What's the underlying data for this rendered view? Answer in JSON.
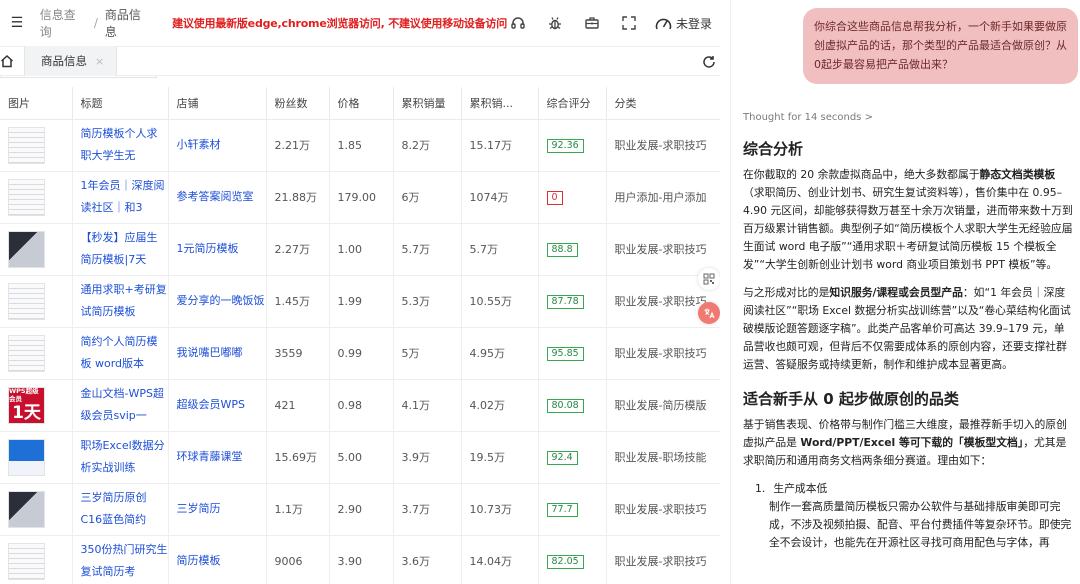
{
  "header": {
    "breadcrumb_1": "信息查询",
    "breadcrumb_sep": "/",
    "breadcrumb_2": "商品信息",
    "warning": "建议使用最新版edge,chrome浏览器访问, 不建议使用移动设备访问",
    "login": "未登录"
  },
  "tabs": {
    "active": "商品信息",
    "close": "×"
  },
  "table": {
    "columns": [
      "图片",
      "标题",
      "店铺",
      "粉丝数",
      "价格",
      "累积销量",
      "累积销...",
      "综合评分",
      "分类"
    ],
    "rows": [
      {
        "title": "简历模板个人求职大学生无",
        "shop": "小轩素材",
        "fans": "2.21万",
        "price": "1.85",
        "sales": "8.2万",
        "amount": "15.17万",
        "score": "92.36",
        "category": "职业发展-求职技巧",
        "thumb": "stripe",
        "score_color": "#35a852"
      },
      {
        "title": "1年会员｜深度阅读社区｜和3",
        "shop": "参考答案阅览室",
        "fans": "21.88万",
        "price": "179.00",
        "sales": "6万",
        "amount": "1074万",
        "score": "0",
        "category": "用户添加-用户添加",
        "thumb": "stripe",
        "score_color": "#d92f2f"
      },
      {
        "title": "【秒发】应届生简历模板|7天",
        "shop": "1元简历模板",
        "fans": "2.27万",
        "price": "1.00",
        "sales": "5.7万",
        "amount": "5.7万",
        "score": "88.8",
        "category": "职业发展-求职技巧",
        "thumb": "dark",
        "score_color": "#35a852"
      },
      {
        "title": "通用求职+考研复试简历模板",
        "shop": "爱分享的一晚饭饭",
        "fans": "1.45万",
        "price": "1.99",
        "sales": "5.3万",
        "amount": "10.55万",
        "score": "87.78",
        "category": "职业发展-求职技巧",
        "thumb": "stripe",
        "score_color": "#35a852"
      },
      {
        "title": "简约个人简历模板 word版本",
        "shop": "我说嘴巴嘟嘟",
        "fans": "3559",
        "price": "0.99",
        "sales": "5万",
        "amount": "4.95万",
        "score": "95.85",
        "category": "职业发展-求职技巧",
        "thumb": "stripe",
        "score_color": "#35a852"
      },
      {
        "title": "金山文档-WPS超级会员svip一",
        "shop": "超级会员WPS",
        "fans": "421",
        "price": "0.98",
        "sales": "4.1万",
        "amount": "4.02万",
        "score": "80.08",
        "category": "职业发展-简历模版",
        "thumb": "red",
        "score_color": "#35a852"
      },
      {
        "title": "职场Excel数据分析实战训练",
        "shop": "环球青藤课堂",
        "fans": "15.69万",
        "price": "5.00",
        "sales": "3.9万",
        "amount": "19.5万",
        "score": "92.4",
        "category": "职业发展-职场技能",
        "thumb": "blue",
        "score_color": "#35a852"
      },
      {
        "title": "三岁简历原创C16蓝色简约",
        "shop": "三岁简历",
        "fans": "1.1万",
        "price": "2.90",
        "sales": "3.7万",
        "amount": "10.73万",
        "score": "77.7",
        "category": "职业发展-求职技巧",
        "thumb": "dark",
        "score_color": "#35a852"
      },
      {
        "title": "350份热门研究生复试简历考",
        "shop": "简历模板",
        "fans": "9006",
        "price": "3.90",
        "sales": "3.6万",
        "amount": "14.04万",
        "score": "82.05",
        "category": "职业发展-求职技巧",
        "thumb": "stripe",
        "score_color": "#35a852"
      }
    ],
    "thumb_wps_top": "WPS超级会员",
    "thumb_wps_big": "1天"
  },
  "chat": {
    "user_message": "你综合这些商品信息帮我分析，一个新手如果要做原创虚拟产品的话，那个类型的产品最适合做原创？从0起步最容易把产品做出来？",
    "thought": "Thought for 14 seconds",
    "thought_chevron": ">",
    "h1": "综合分析",
    "p1_a": "在你截取的 20 余款虚拟商品中，绝大多数都属于",
    "p1_b": "静态文档类模板",
    "p1_c": "（求职简历、创业计划书、研究生复试资料等），售价集中在 0.95–4.90 元区间，却能够获得数万甚至十余万次销量，进而带来数十万到百万级累计销售额。典型例子如“简历模板个人求职大学生无经验应届生面试 word 电子版”“通用求职＋考研复试简历模板 15 个模板全发”“大学生创新创业计划书 word 商业项目策划书 PPT 模板”等。",
    "p2_a": "与之形成对比的是",
    "p2_b": "知识服务/课程或会员型产品",
    "p2_c": "：如“1 年会员｜深度阅读社区”“职场 Excel 数据分析实战训练营”以及“卷心菜结构化面试破模版论题答题逐字稿”。此类产品客单价可高达 39.9–179 元，单品营收也颇可观，但背后不仅需要成体系的原创内容，还要支撑社群运营、答疑服务或持续更新，制作和维护成本显著更高。",
    "h2": "适合新手从 0 起步做原创的品类",
    "p3_a": "基于销售表现、价格带与制作门槛三大维度，最推荐新手切入的原创虚拟产品是 ",
    "p3_b": "Word/PPT/Excel 等可下载的「模板型文档」",
    "p3_c": "，尤其是求职简历和通用商务文档两条细分赛道。理由如下：",
    "li1_num": "1.",
    "li1_title": "生产成本低",
    "li1_body": "制作一套高质量简历模板只需办公软件与基础排版审美即可完成，不涉及视频拍摄、配音、平台付费插件等复杂环节。即使完全不会设计，也能先在开源社区寻找可商用配色与字体，再"
  }
}
